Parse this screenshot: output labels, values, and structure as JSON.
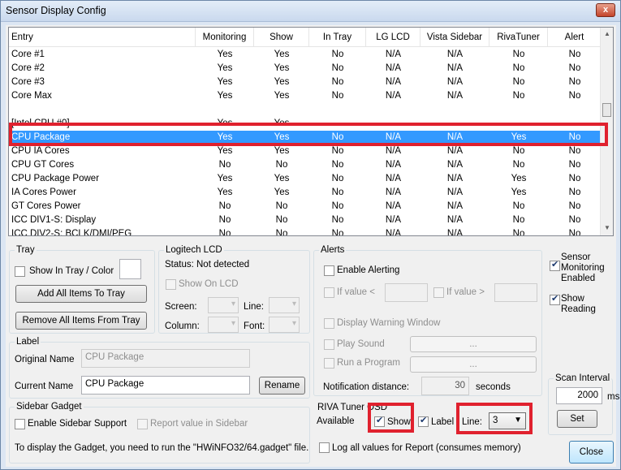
{
  "window": {
    "title": "Sensor Display Config",
    "close_glyph": "x"
  },
  "columns": [
    "Entry",
    "Monitoring",
    "Show",
    "In Tray",
    "LG LCD",
    "Vista Sidebar",
    "RivaTuner",
    "Alert"
  ],
  "rows": [
    [
      "Core #1",
      "Yes",
      "Yes",
      "No",
      "N/A",
      "N/A",
      "No",
      "No"
    ],
    [
      "Core #2",
      "Yes",
      "Yes",
      "No",
      "N/A",
      "N/A",
      "No",
      "No"
    ],
    [
      "Core #3",
      "Yes",
      "Yes",
      "No",
      "N/A",
      "N/A",
      "No",
      "No"
    ],
    [
      "Core Max",
      "Yes",
      "Yes",
      "No",
      "N/A",
      "N/A",
      "No",
      "No"
    ],
    [
      "",
      "",
      "",
      "",
      "",
      "",
      "",
      ""
    ],
    [
      "[Intel CPU #0]",
      "Yes",
      "Yes",
      "-",
      "-",
      "-",
      "-",
      "-"
    ],
    [
      "CPU Package",
      "Yes",
      "Yes",
      "No",
      "N/A",
      "N/A",
      "Yes",
      "No"
    ],
    [
      "CPU IA Cores",
      "Yes",
      "Yes",
      "No",
      "N/A",
      "N/A",
      "No",
      "No"
    ],
    [
      "CPU GT Cores",
      "No",
      "No",
      "No",
      "N/A",
      "N/A",
      "No",
      "No"
    ],
    [
      "CPU Package Power",
      "Yes",
      "Yes",
      "No",
      "N/A",
      "N/A",
      "Yes",
      "No"
    ],
    [
      "IA Cores Power",
      "Yes",
      "Yes",
      "No",
      "N/A",
      "N/A",
      "Yes",
      "No"
    ],
    [
      "GT Cores Power",
      "No",
      "No",
      "No",
      "N/A",
      "N/A",
      "No",
      "No"
    ],
    [
      "ICC DIV1-S: Display",
      "No",
      "No",
      "No",
      "N/A",
      "N/A",
      "No",
      "No"
    ],
    [
      "ICC DIV2-S: BCLK/DMI/PEG",
      "No",
      "No",
      "No",
      "N/A",
      "N/A",
      "No",
      "No"
    ]
  ],
  "tray": {
    "title": "Tray",
    "show_in_tray": "Show In Tray / Color",
    "add_all": "Add All Items To Tray",
    "remove_all": "Remove All Items From Tray"
  },
  "lcd": {
    "title": "Logitech LCD",
    "status": "Status: Not detected",
    "show_on_lcd": "Show On LCD",
    "screen": "Screen:",
    "line": "Line:",
    "column": "Column:",
    "font": "Font:"
  },
  "alerts": {
    "title": "Alerts",
    "enable": "Enable Alerting",
    "if_below": "If value <",
    "if_above": "If value >",
    "warning_window": "Display Warning Window",
    "play_sound": "Play Sound",
    "run_program": "Run a Program",
    "browse": "...",
    "notification_distance": "Notification distance:",
    "distance_value": "30",
    "seconds": "seconds"
  },
  "sensor": {
    "monitoring": "Sensor Monitoring Enabled",
    "show_reading": "Show Reading"
  },
  "label": {
    "title": "Label",
    "original_name": "Original Name",
    "original_value": "CPU Package",
    "current_name": "Current Name",
    "current_value": "CPU Package",
    "rename": "Rename"
  },
  "scan": {
    "title": "Scan Interval",
    "value": "2000",
    "unit": "ms",
    "set": "Set"
  },
  "sidebar": {
    "title": "Sidebar Gadget",
    "enable": "Enable Sidebar Support",
    "report": "Report value in Sidebar",
    "info": "To display the Gadget, you need to run the \"HWiNFO32/64.gadget\" file."
  },
  "riva": {
    "title": "RIVA Tuner OSD",
    "available": "Available",
    "show": "Show",
    "label": "Label",
    "line": "Line:",
    "line_value": "3"
  },
  "log": {
    "label": "Log all values for Report (consumes memory)"
  },
  "close": "Close"
}
